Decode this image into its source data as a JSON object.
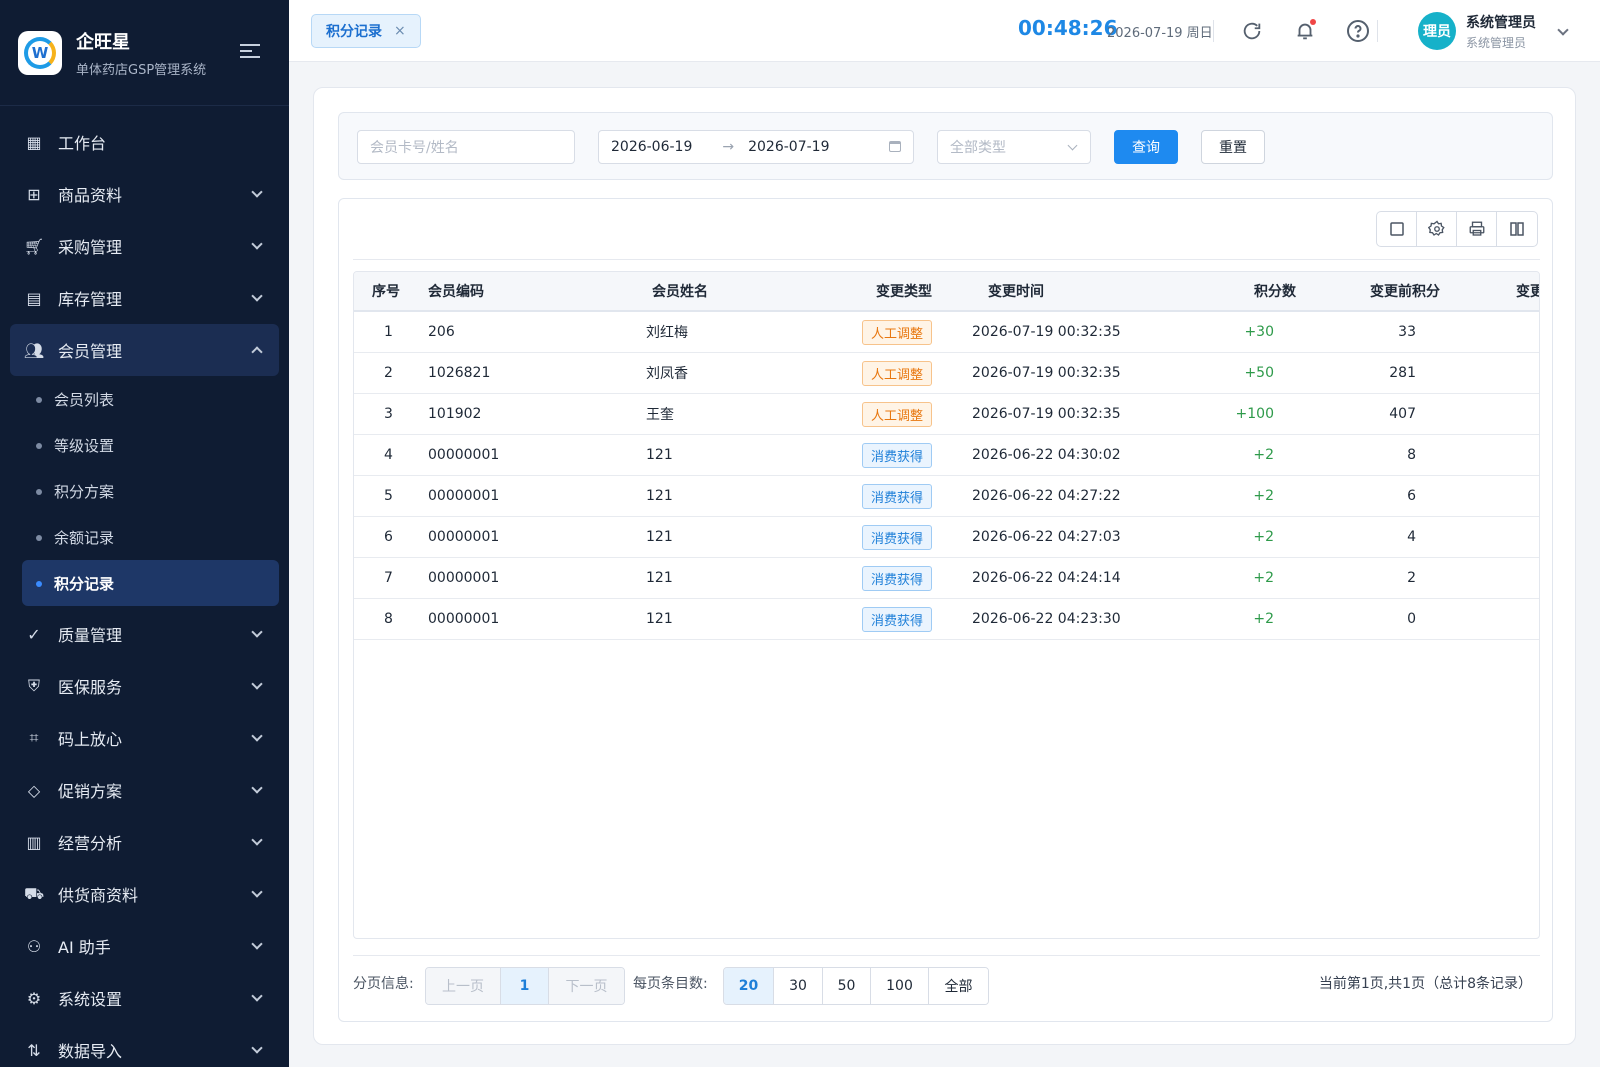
{
  "brand": {
    "name": "企旺星",
    "subtitle": "单体药店GSP管理系统",
    "logo_letter": "W"
  },
  "sidebar": {
    "items": [
      {
        "label": "工作台",
        "icon": "dashboard-icon"
      },
      {
        "label": "商品资料",
        "icon": "product-icon"
      },
      {
        "label": "采购管理",
        "icon": "cart-icon"
      },
      {
        "label": "库存管理",
        "icon": "inventory-icon"
      },
      {
        "label": "会员管理",
        "icon": "members-icon"
      },
      {
        "label": "质量管理",
        "icon": "quality-icon"
      },
      {
        "label": "医保服务",
        "icon": "shield-icon"
      },
      {
        "label": "码上放心",
        "icon": "qrcode-icon"
      },
      {
        "label": "促销方案",
        "icon": "tag-icon"
      },
      {
        "label": "经营分析",
        "icon": "chart-icon"
      },
      {
        "label": "供货商资料",
        "icon": "truck-icon"
      },
      {
        "label": "AI 助手",
        "icon": "robot-icon"
      },
      {
        "label": "系统设置",
        "icon": "gear-icon"
      },
      {
        "label": "数据导入",
        "icon": "import-icon"
      }
    ],
    "member_sub": [
      "会员列表",
      "等级设置",
      "积分方案",
      "余额记录",
      "积分记录"
    ]
  },
  "header": {
    "tab_label": "积分记录",
    "tab_close": "×",
    "clock": "00:48:26",
    "date": "2026-07-19 周日",
    "user_avatar": "理员",
    "user_name": "系统管理员",
    "user_role": "系统管理员"
  },
  "filter": {
    "member_placeholder": "会员卡号/姓名",
    "date_start": "2026-06-19",
    "date_arrow": "→",
    "date_end": "2026-07-19",
    "type_placeholder": "全部类型",
    "query_label": "查询",
    "reset_label": "重置"
  },
  "table": {
    "columns": [
      "序号",
      "会员编码",
      "会员姓名",
      "变更类型",
      "变更时间",
      "积分数",
      "变更前积分",
      "变更"
    ],
    "rows": [
      {
        "no": "1",
        "code": "206",
        "name": "刘红梅",
        "type": "人工调整",
        "type_color": "orange",
        "time": "2026-07-19 00:32:35",
        "points": "+30",
        "before": "33"
      },
      {
        "no": "2",
        "code": "1026821",
        "name": "刘凤香",
        "type": "人工调整",
        "type_color": "orange",
        "time": "2026-07-19 00:32:35",
        "points": "+50",
        "before": "281"
      },
      {
        "no": "3",
        "code": "101902",
        "name": "王奎",
        "type": "人工调整",
        "type_color": "orange",
        "time": "2026-07-19 00:32:35",
        "points": "+100",
        "before": "407"
      },
      {
        "no": "4",
        "code": "00000001",
        "name": "121",
        "type": "消费获得",
        "type_color": "blue",
        "time": "2026-06-22 04:30:02",
        "points": "+2",
        "before": "8"
      },
      {
        "no": "5",
        "code": "00000001",
        "name": "121",
        "type": "消费获得",
        "type_color": "blue",
        "time": "2026-06-22 04:27:22",
        "points": "+2",
        "before": "6"
      },
      {
        "no": "6",
        "code": "00000001",
        "name": "121",
        "type": "消费获得",
        "type_color": "blue",
        "time": "2026-06-22 04:27:03",
        "points": "+2",
        "before": "4"
      },
      {
        "no": "7",
        "code": "00000001",
        "name": "121",
        "type": "消费获得",
        "type_color": "blue",
        "time": "2026-06-22 04:24:14",
        "points": "+2",
        "before": "2"
      },
      {
        "no": "8",
        "code": "00000001",
        "name": "121",
        "type": "消费获得",
        "type_color": "blue",
        "time": "2026-06-22 04:23:30",
        "points": "+2",
        "before": "0"
      }
    ]
  },
  "pager": {
    "info_label": "分页信息:",
    "prev": "上一页",
    "current": "1",
    "next": "下一页",
    "size_label": "每页条目数:",
    "sizes": [
      "20",
      "30",
      "50",
      "100",
      "全部"
    ],
    "selected_size": "20",
    "summary": "当前第1页,共1页（总计8条记录）"
  },
  "colors": {
    "accent": "#1e8af0",
    "sidebar_bg": "#0f1c33",
    "positive": "#2e9a4a"
  }
}
